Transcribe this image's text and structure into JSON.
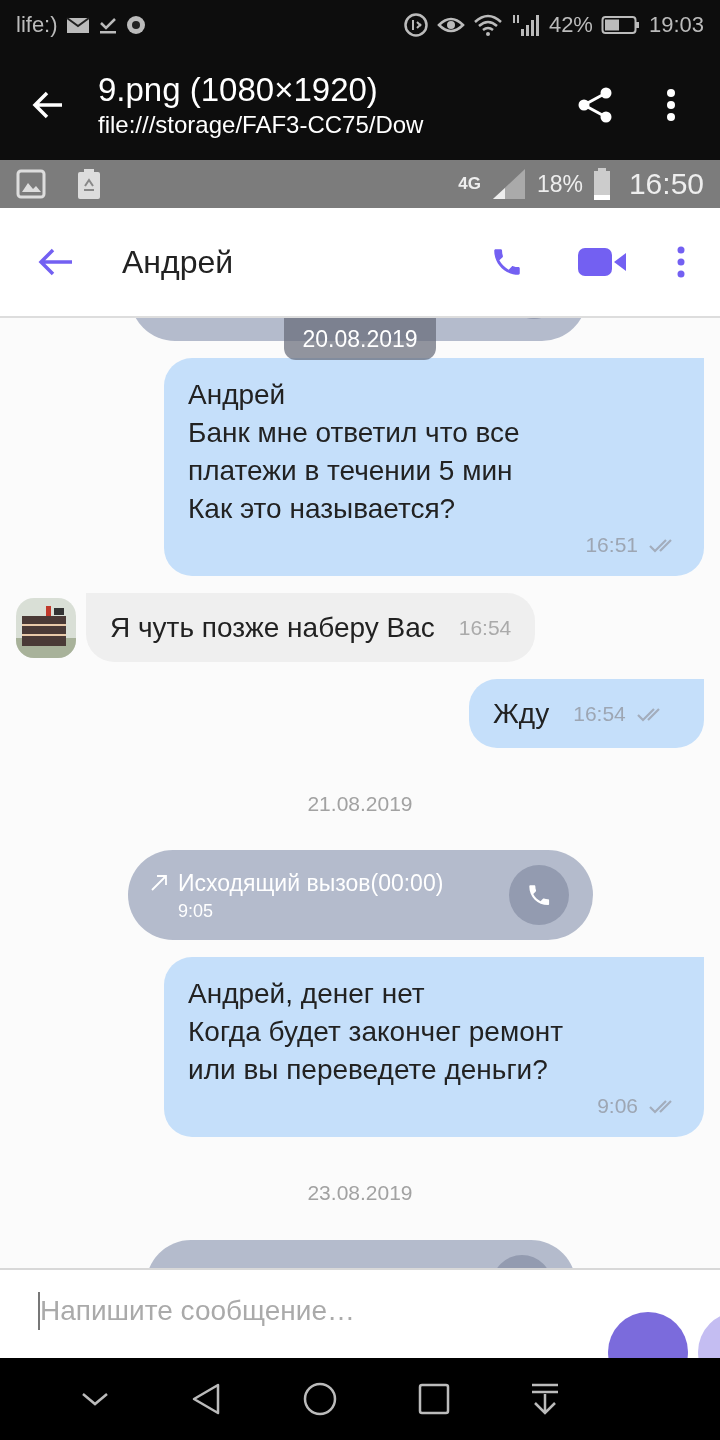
{
  "device_status_bar": {
    "carrier": "life:)",
    "battery": "42%",
    "time": "19:03"
  },
  "viewer_toolbar": {
    "title": "9.png (1080×1920)",
    "path": "file:///storage/FAF3-CC75/Dow"
  },
  "screenshot_status_bar": {
    "network": "4G",
    "battery": "18%",
    "time": "16:50"
  },
  "chat_header": {
    "contact": "Андрей"
  },
  "chat": {
    "floating_date": "20.08.2019",
    "messages": [
      {
        "kind": "clipped_call"
      },
      {
        "kind": "outgoing",
        "lines": [
          "Андрей",
          "Банк мне ответил что все",
          "платежи в течении 5 мин",
          "Как это называется?"
        ],
        "time": "16:51"
      },
      {
        "kind": "incoming",
        "lines": [
          "Я чуть позже наберу Вас"
        ],
        "time": "16:54"
      },
      {
        "kind": "outgoing",
        "lines": [
          "Жду"
        ],
        "time": "16:54"
      },
      {
        "kind": "date",
        "text": "21.08.2019"
      },
      {
        "kind": "call",
        "text": "Исходящий вызов(00:00)",
        "time": "9:05"
      },
      {
        "kind": "outgoing",
        "lines": [
          "Андрей, денег нет",
          "Когда будет закончег ремонт",
          "или вы переведете деньги?"
        ],
        "time": "9:06"
      },
      {
        "kind": "date",
        "text": "23.08.2019"
      },
      {
        "kind": "clipped_call"
      }
    ]
  },
  "composer": {
    "placeholder": "Напишите сообщение…"
  }
}
